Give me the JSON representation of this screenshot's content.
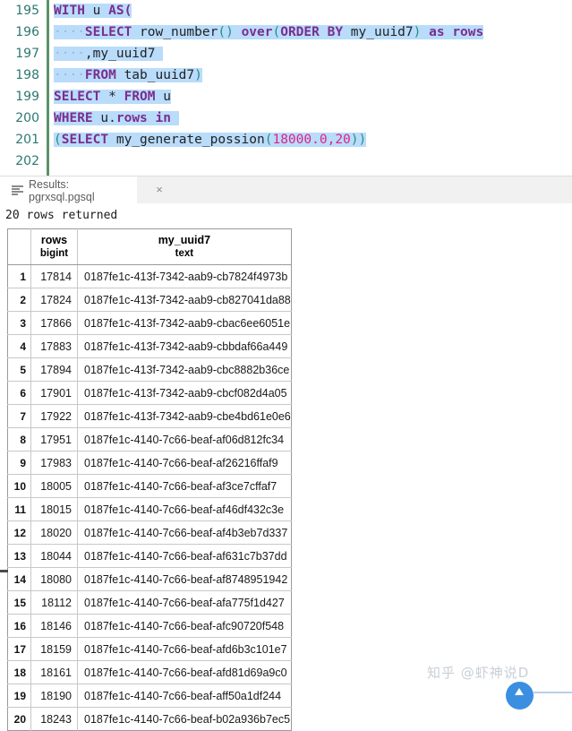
{
  "editor": {
    "first_line_number": 195,
    "lines": [
      {
        "num": "195",
        "tokens": [
          {
            "t": "WITH",
            "c": "kw",
            "hl": true
          },
          {
            "t": " ",
            "c": "sp",
            "hl": true
          },
          {
            "t": "u",
            "c": "id",
            "hl": true
          },
          {
            "t": " ",
            "c": "sp",
            "hl": true
          },
          {
            "t": "AS(",
            "c": "kw",
            "hl": true
          }
        ]
      },
      {
        "num": "196",
        "tokens": [
          {
            "t": "····",
            "c": "dot",
            "hl": true
          },
          {
            "t": "SELECT",
            "c": "kw",
            "hl": true
          },
          {
            "t": " ",
            "c": "sp",
            "hl": true
          },
          {
            "t": "row_number",
            "c": "id",
            "hl": true
          },
          {
            "t": "()",
            "c": "paren",
            "hl": true
          },
          {
            "t": " ",
            "c": "sp",
            "hl": true
          },
          {
            "t": "over",
            "c": "kw",
            "hl": true
          },
          {
            "t": "(",
            "c": "paren",
            "hl": true
          },
          {
            "t": "ORDER BY",
            "c": "kw",
            "hl": true
          },
          {
            "t": " ",
            "c": "sp",
            "hl": true
          },
          {
            "t": "my_uuid7",
            "c": "id",
            "hl": true
          },
          {
            "t": ")",
            "c": "paren",
            "hl": true
          },
          {
            "t": " ",
            "c": "sp",
            "hl": true
          },
          {
            "t": "as",
            "c": "kw",
            "hl": true
          },
          {
            "t": " ",
            "c": "sp",
            "hl": true
          },
          {
            "t": "rows",
            "c": "kw",
            "hl": true
          }
        ]
      },
      {
        "num": "197",
        "tokens": [
          {
            "t": "····",
            "c": "dot",
            "hl": true
          },
          {
            "t": ",my_uuid7 ",
            "c": "id",
            "hl": true
          }
        ]
      },
      {
        "num": "198",
        "tokens": [
          {
            "t": "····",
            "c": "dot",
            "hl": true
          },
          {
            "t": "FROM",
            "c": "kw",
            "hl": true
          },
          {
            "t": " ",
            "c": "sp",
            "hl": true
          },
          {
            "t": "tab_uuid7",
            "c": "id",
            "hl": true
          },
          {
            "t": ")",
            "c": "paren",
            "hl": true
          }
        ]
      },
      {
        "num": "199",
        "tokens": [
          {
            "t": "SELECT",
            "c": "kw",
            "hl": true
          },
          {
            "t": " ",
            "c": "sp",
            "hl": true
          },
          {
            "t": "*",
            "c": "id",
            "hl": true
          },
          {
            "t": " ",
            "c": "sp",
            "hl": true
          },
          {
            "t": "FROM",
            "c": "kw",
            "hl": true
          },
          {
            "t": " ",
            "c": "sp",
            "hl": true
          },
          {
            "t": "u",
            "c": "id",
            "hl": true
          }
        ]
      },
      {
        "num": "200",
        "tokens": [
          {
            "t": "WHERE",
            "c": "kw",
            "hl": true
          },
          {
            "t": " ",
            "c": "sp",
            "hl": true
          },
          {
            "t": "u.",
            "c": "id",
            "hl": true
          },
          {
            "t": "rows",
            "c": "kw",
            "hl": true
          },
          {
            "t": " ",
            "c": "sp",
            "hl": true
          },
          {
            "t": "in",
            "c": "kw",
            "hl": true
          },
          {
            "t": " ",
            "c": "sp",
            "hl": true
          }
        ]
      },
      {
        "num": "201",
        "tokens": [
          {
            "t": "(",
            "c": "paren",
            "hl": true
          },
          {
            "t": "SELECT",
            "c": "kw",
            "hl": true
          },
          {
            "t": " ",
            "c": "sp",
            "hl": true
          },
          {
            "t": "my_generate_possion",
            "c": "id",
            "hl": true
          },
          {
            "t": "(",
            "c": "paren",
            "hl": true
          },
          {
            "t": "18000.0",
            "c": "num",
            "hl": true
          },
          {
            "t": ",",
            "c": "num",
            "hl": true
          },
          {
            "t": "20",
            "c": "num",
            "hl": true
          },
          {
            "t": "))",
            "c": "paren",
            "hl": true
          }
        ]
      },
      {
        "num": "202",
        "tokens": []
      }
    ]
  },
  "results_tab": {
    "icon": "list-lines-icon",
    "label": "Results: pgrxsql.pgsql",
    "close_label": "×"
  },
  "status": {
    "text": "20 rows returned"
  },
  "grid": {
    "columns": [
      {
        "name": "",
        "type": ""
      },
      {
        "name": "rows",
        "type": "bigint"
      },
      {
        "name": "my_uuid7",
        "type": "text"
      }
    ],
    "rows": [
      {
        "idx": "1",
        "rows": "17814",
        "uuid": "0187fe1c-413f-7342-aab9-cb7824f4973b"
      },
      {
        "idx": "2",
        "rows": "17824",
        "uuid": "0187fe1c-413f-7342-aab9-cb827041da88"
      },
      {
        "idx": "3",
        "rows": "17866",
        "uuid": "0187fe1c-413f-7342-aab9-cbac6ee6051e"
      },
      {
        "idx": "4",
        "rows": "17883",
        "uuid": "0187fe1c-413f-7342-aab9-cbbdaf66a449"
      },
      {
        "idx": "5",
        "rows": "17894",
        "uuid": "0187fe1c-413f-7342-aab9-cbc8882b36ce"
      },
      {
        "idx": "6",
        "rows": "17901",
        "uuid": "0187fe1c-413f-7342-aab9-cbcf082d4a05"
      },
      {
        "idx": "7",
        "rows": "17922",
        "uuid": "0187fe1c-413f-7342-aab9-cbe4bd61e0e6"
      },
      {
        "idx": "8",
        "rows": "17951",
        "uuid": "0187fe1c-4140-7c66-beaf-af06d812fc34"
      },
      {
        "idx": "9",
        "rows": "17983",
        "uuid": "0187fe1c-4140-7c66-beaf-af26216ffaf9"
      },
      {
        "idx": "10",
        "rows": "18005",
        "uuid": "0187fe1c-4140-7c66-beaf-af3ce7cffaf7"
      },
      {
        "idx": "11",
        "rows": "18015",
        "uuid": "0187fe1c-4140-7c66-beaf-af46df432c3e"
      },
      {
        "idx": "12",
        "rows": "18020",
        "uuid": "0187fe1c-4140-7c66-beaf-af4b3eb7d337"
      },
      {
        "idx": "13",
        "rows": "18044",
        "uuid": "0187fe1c-4140-7c66-beaf-af631c7b37dd"
      },
      {
        "idx": "14",
        "rows": "18080",
        "uuid": "0187fe1c-4140-7c66-beaf-af8748951942"
      },
      {
        "idx": "15",
        "rows": "18112",
        "uuid": "0187fe1c-4140-7c66-beaf-afa775f1d427"
      },
      {
        "idx": "16",
        "rows": "18146",
        "uuid": "0187fe1c-4140-7c66-beaf-afc90720f548"
      },
      {
        "idx": "17",
        "rows": "18159",
        "uuid": "0187fe1c-4140-7c66-beaf-afd6b3c101e7"
      },
      {
        "idx": "18",
        "rows": "18161",
        "uuid": "0187fe1c-4140-7c66-beaf-afd81d69a9c0"
      },
      {
        "idx": "19",
        "rows": "18190",
        "uuid": "0187fe1c-4140-7c66-beaf-aff50a1df244"
      },
      {
        "idx": "20",
        "rows": "18243",
        "uuid": "0187fe1c-4140-7c66-beaf-b02a936b7ec5"
      }
    ]
  },
  "watermark": {
    "text": "知乎 @虾神说D"
  },
  "colors": {
    "selection": "#b9dcfb",
    "keyword": "#7b2d8e",
    "paren": "#2a8c82",
    "number": "#e0218a",
    "gutter_text": "#2c7873",
    "gutter_bar": "#5a9367",
    "badge_blue": "#3b8fe0"
  }
}
